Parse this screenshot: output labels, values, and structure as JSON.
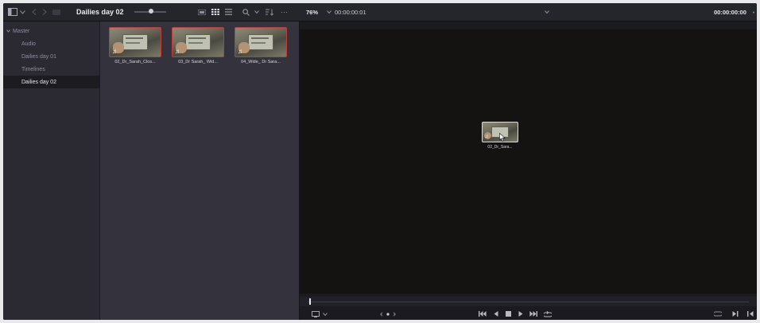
{
  "toolbar": {
    "bin_title": "Dailies day 02",
    "zoom_level": "76%",
    "source_timecode": "00:00:00:01",
    "record_timecode": "00:00:00:00",
    "more_label": "···"
  },
  "sidebar": {
    "items": [
      {
        "label": "Master"
      },
      {
        "label": "Audio"
      },
      {
        "label": "Dailies day 01"
      },
      {
        "label": "Timelines"
      },
      {
        "label": "Dailies day 02"
      }
    ],
    "selected": "Dailies day 02"
  },
  "clips": [
    {
      "label": "02_Dr_Sarah_Clos..."
    },
    {
      "label": "03_Dr Sarah_ Wid..."
    },
    {
      "label": "04_Wide_ Dr Sara..."
    }
  ],
  "dragged_clip": {
    "label": "02_Dr_Sara..."
  },
  "colors": {
    "accent_border": "#c43a36",
    "selected_bg": "#1b1b20"
  },
  "icons": [
    "panel-toggle-icon",
    "chevron-down-icon",
    "back-icon",
    "forward-icon",
    "list-view-icon",
    "thumbnail-view-icon",
    "metadata-view-icon",
    "search-icon",
    "sort-icon",
    "monitor-icon",
    "jog-icon",
    "skip-back-icon",
    "step-back-icon",
    "stop-icon",
    "play-icon",
    "skip-forward-icon",
    "loop-icon",
    "match-frame-icon",
    "mark-in-icon",
    "mark-out-icon"
  ]
}
